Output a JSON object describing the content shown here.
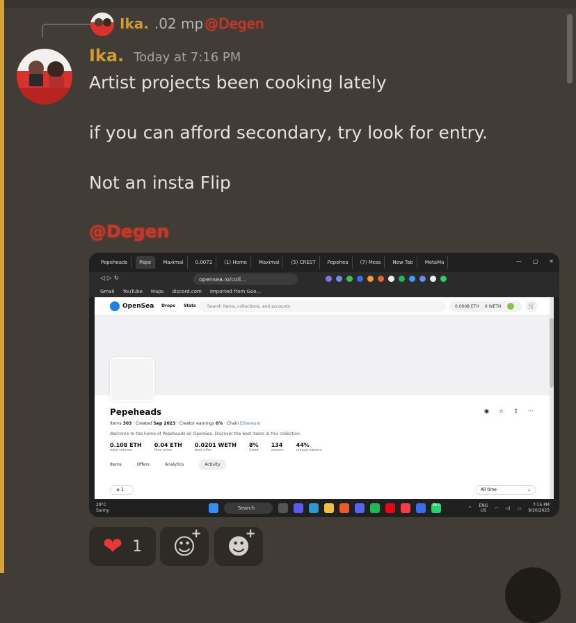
{
  "reply": {
    "username": "Ika.",
    "preview_text": ".02 mp",
    "mention": "@Degen"
  },
  "message": {
    "username": "Ika.",
    "timestamp": "Today at 7:16 PM",
    "lines": [
      "Artist projects been cooking lately",
      "if you can afford secondary, try look for entry.",
      "Not an insta Flip"
    ],
    "mention": "@Degen"
  },
  "screenshot": {
    "tabs": [
      "Pepeheads",
      "Pepe",
      "Maximal",
      "0.0072",
      "(1) Home",
      "Maximal",
      "(5) CREST",
      "Pepehea",
      "(7) Mess",
      "New Tab",
      "MetaMa"
    ],
    "url": "opensea.io/coll...",
    "bookmarks": [
      "Gmail",
      "YouTube",
      "Maps",
      "discord.com",
      "Imported from Goo..."
    ],
    "opensea": {
      "brand": "OpenSea",
      "nav": [
        "Drops",
        "Stats"
      ],
      "search_placeholder": "Search items, collections, and accounts",
      "wallet_eth": "0.0008 ETH",
      "wallet_weth": "0 WETH",
      "collection_title": "Pepeheads",
      "meta_items_label": "Items",
      "meta_items": "303",
      "meta_created_label": "Created",
      "meta_created": "Sep 2023",
      "meta_earnings_label": "Creator earnings",
      "meta_earnings": "0%",
      "meta_chain_label": "Chain",
      "meta_chain": "Ethereum",
      "description": "Welcome to the home of Pepeheads on OpenSea. Discover the best items in this collection.",
      "stats": [
        {
          "value": "0.108 ETH",
          "label": "total volume"
        },
        {
          "value": "0.04 ETH",
          "label": "floor price"
        },
        {
          "value": "0.0201 WETH",
          "label": "best offer"
        },
        {
          "value": "8%",
          "label": "listed"
        },
        {
          "value": "134",
          "label": "owners"
        },
        {
          "value": "44%",
          "label": "unique owners"
        }
      ],
      "tabs": [
        "Items",
        "Offers",
        "Analytics",
        "Activity"
      ],
      "filter_count": "1",
      "time_range": "All time"
    },
    "taskbar": {
      "temp": "29°C",
      "weather": "Sunny",
      "search": "Search",
      "lang": "ENG",
      "region": "US",
      "time": "7:15 PM",
      "date": "9/20/2023",
      "badge": "99+"
    }
  },
  "reactions": {
    "heart_count": "1"
  }
}
